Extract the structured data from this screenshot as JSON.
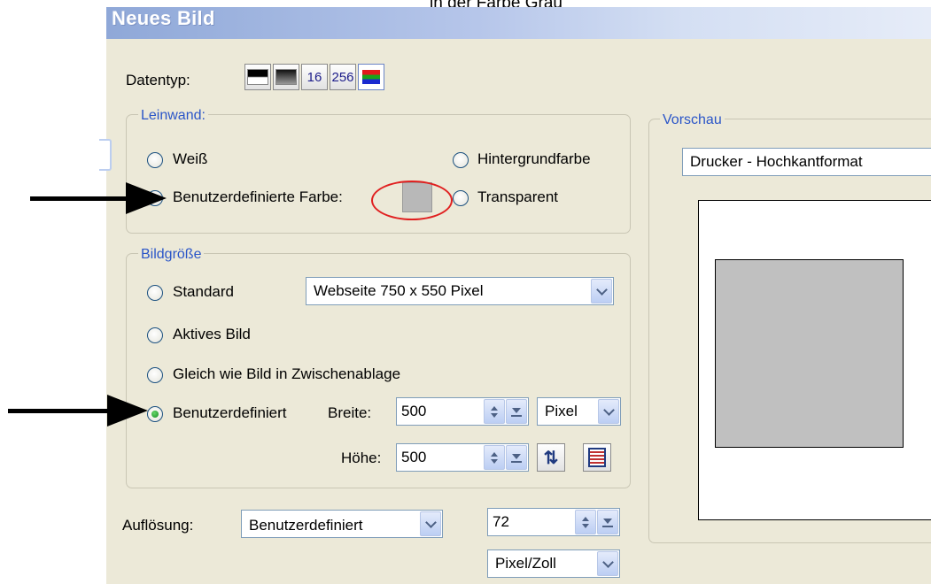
{
  "caption": "in der Farbe Grau",
  "window": {
    "title": "Neues Bild"
  },
  "datentyp": {
    "label": "Datentyp:",
    "buttons": [
      {
        "icon": "black-white-gradient-icon"
      },
      {
        "icon": "grayscale-icon"
      },
      {
        "label": "16"
      },
      {
        "label": "256"
      },
      {
        "icon": "rgb-color-icon",
        "selected": true
      }
    ]
  },
  "leinwand": {
    "legend": "Leinwand:",
    "weiss": "Weiß",
    "hintergrundfarbe": "Hintergrundfarbe",
    "benutzerdefinierte_farbe": "Benutzerdefinierte Farbe:",
    "transparent": "Transparent",
    "selected": "benutzerdefinierte_farbe",
    "swatch_color": "#b8b8b8"
  },
  "bildgroesse": {
    "legend": "Bildgröße",
    "standard": "Standard",
    "standard_combo": "Webseite 750 x 550 Pixel",
    "aktives_bild": "Aktives Bild",
    "zwischenablage": "Gleich wie Bild in Zwischenablage",
    "benutzerdefiniert": "Benutzerdefiniert",
    "selected": "benutzerdefiniert",
    "breite_label": "Breite:",
    "breite_value": "500",
    "hoehe_label": "Höhe:",
    "hoehe_value": "500",
    "unit": "Pixel"
  },
  "aufloesung": {
    "label": "Auflösung:",
    "combo": "Benutzerdefiniert",
    "value": "72",
    "unit": "Pixel/Zoll"
  },
  "vorschau": {
    "legend": "Vorschau",
    "format": "Drucker - Hochkantformat",
    "canvas_color": "#c0c0c0"
  },
  "colors": {
    "window_bg": "#ECE9D8",
    "highlight_circle": "#e02020",
    "arrow": "#000000"
  }
}
